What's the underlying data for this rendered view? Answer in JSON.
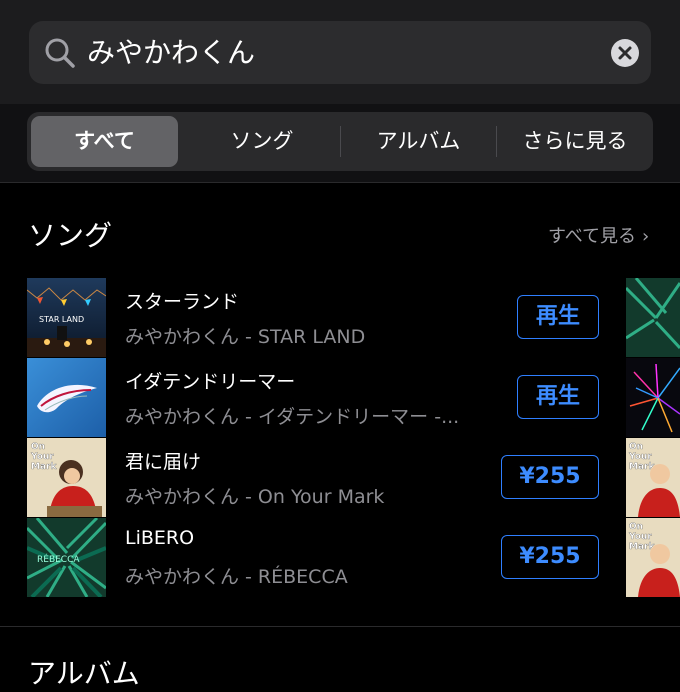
{
  "search": {
    "query": "みやかわくん",
    "icon": "search-icon",
    "clear_icon": "clear-icon"
  },
  "tabs": [
    {
      "label": "すべて",
      "selected": true
    },
    {
      "label": "ソング",
      "selected": false
    },
    {
      "label": "アルバム",
      "selected": false
    },
    {
      "label": "さらに見る",
      "selected": false
    }
  ],
  "songs_section": {
    "title": "ソング",
    "see_all": "すべて見る",
    "items": [
      {
        "title": "スターランド",
        "subtitle": "みやかわくん - STAR LAND",
        "action": "再生",
        "art_text": "STAR LAND"
      },
      {
        "title": "イダテンドリーマー",
        "subtitle": "みやかわくん - イダテンドリーマー -...",
        "action": "再生",
        "art_text": ""
      },
      {
        "title": "君に届け",
        "subtitle": "みやかわくん - On Your Mark",
        "action": "¥255",
        "art_text": "On Your Mark"
      },
      {
        "title": "LiBERO",
        "subtitle": "みやかわくん - RÉBECCA",
        "action": "¥255",
        "art_text": "RÉBECCA"
      }
    ]
  },
  "next_section": {
    "title": "アルバム"
  },
  "colors": {
    "accent": "#3d8cff",
    "background": "#000000",
    "secondary_text": "#8e8e93"
  }
}
